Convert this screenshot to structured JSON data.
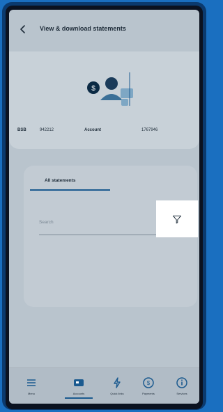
{
  "header": {
    "title": "View & download statements"
  },
  "account": {
    "bsb_label": "BSB",
    "bsb_value": "942212",
    "account_label": "Account",
    "account_value": "1767946"
  },
  "tabs": {
    "active_label": "All statements"
  },
  "search": {
    "placeholder": "Search"
  },
  "bottom_nav": {
    "menu": "Menu",
    "accounts": "Accounts",
    "quick_links": "Quick links",
    "payments": "Payments",
    "services": "Services"
  },
  "icons": {
    "back": "chevron-left-icon",
    "filter": "filter-icon",
    "menu": "hamburger-icon",
    "accounts": "card-icon",
    "quick_links": "lightning-icon",
    "payments": "dollar-circle-icon",
    "services": "info-circle-icon"
  },
  "colors": {
    "outer_blue": "#1a6fc0",
    "frame_dark": "#0b3a6e",
    "accent": "#1b5a8f",
    "overlay_grey": "#b9c4cd",
    "highlight_white": "#ffffff"
  }
}
